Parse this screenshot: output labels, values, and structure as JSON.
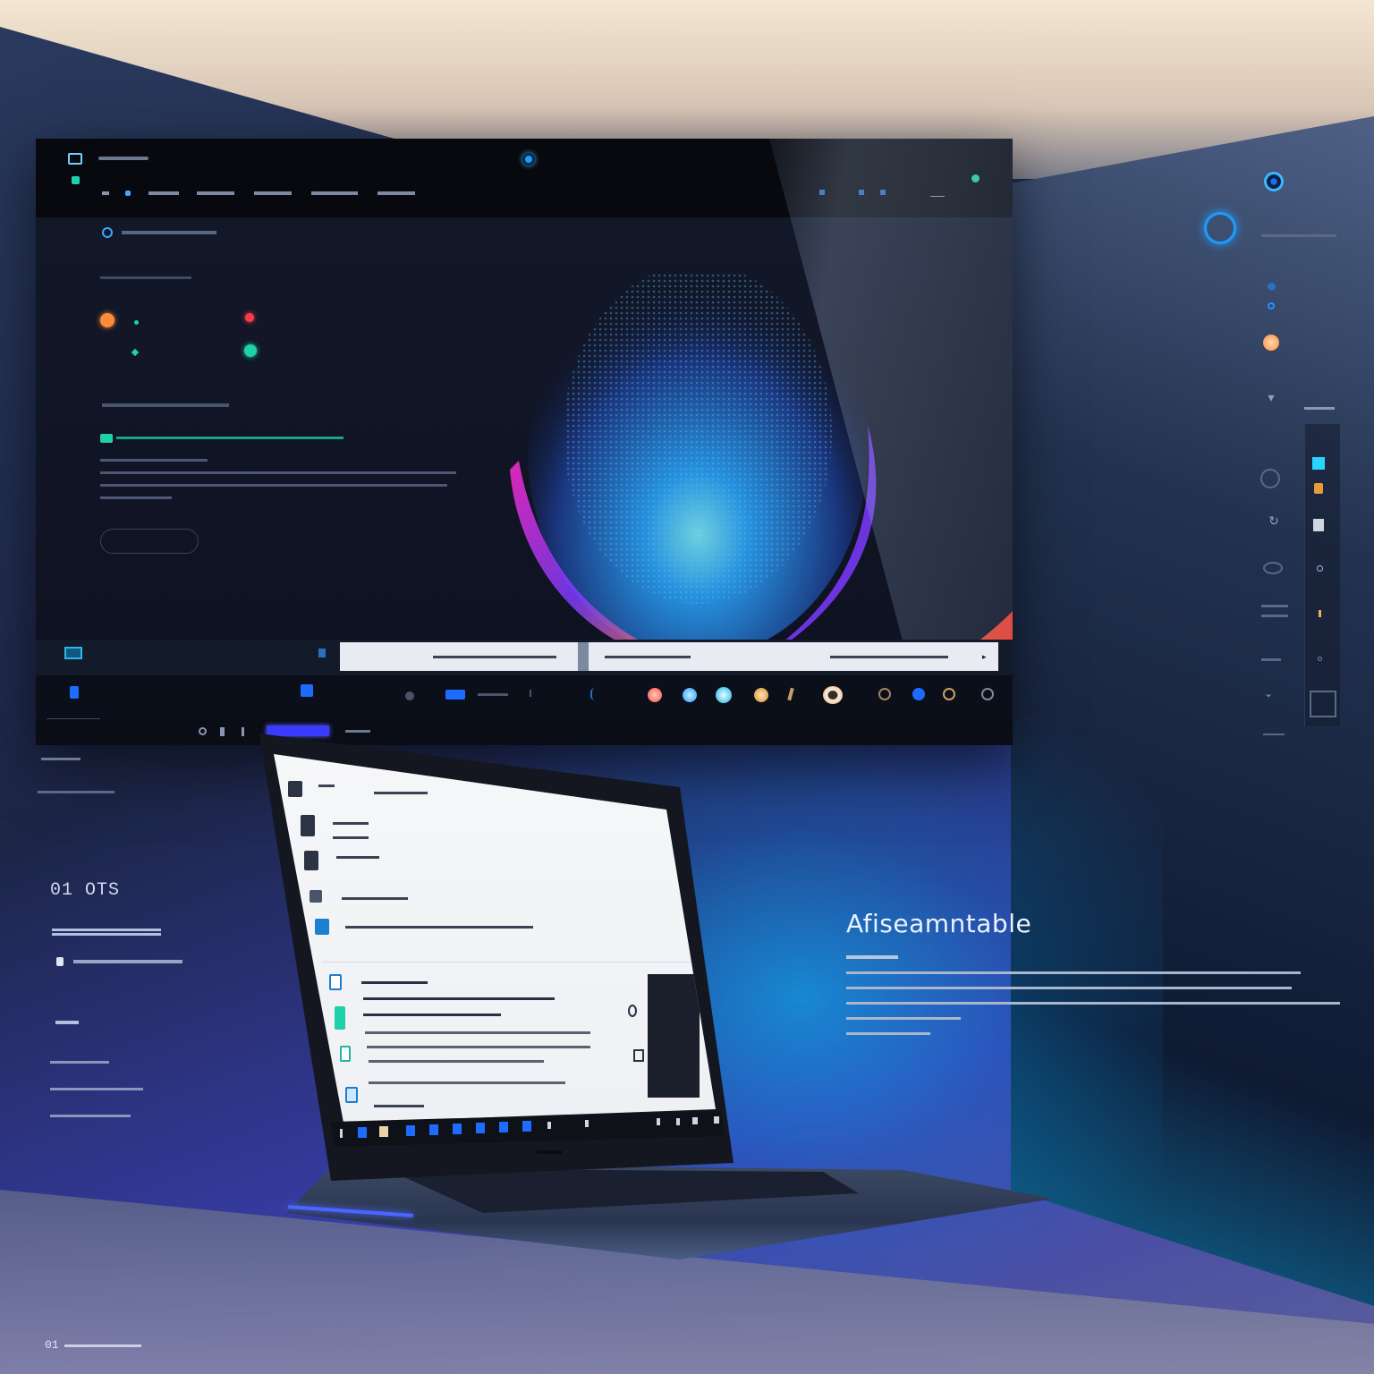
{
  "monitor": {
    "nav_items": [
      "",
      "",
      "",
      "",
      "",
      ""
    ],
    "tabs": [
      {
        "label": ""
      },
      {
        "label": ""
      },
      {
        "label": ""
      }
    ],
    "cta_label": "",
    "status_label": ""
  },
  "left_panel": {
    "headline": "01 OTS"
  },
  "feature": {
    "title": "Afiseamntable"
  },
  "footer": {
    "page": "01"
  },
  "colors": {
    "accent_teal": "#1fd1a8",
    "accent_blue": "#1e9bff",
    "accent_orange": "#ff7a2a",
    "accent_red": "#ff3b4a",
    "cyan_glow": "#00c8ff"
  },
  "icons": {
    "top_left": "app-icon",
    "camera": "camera-lens-icon",
    "right_rail": [
      "circle-icon",
      "target-icon",
      "dot-icon",
      "orange-dot-icon",
      "triangle-icon",
      "settings-icon",
      "refresh-icon",
      "eye-icon",
      "dot-icon",
      "dot-icon",
      "square-icon"
    ]
  }
}
